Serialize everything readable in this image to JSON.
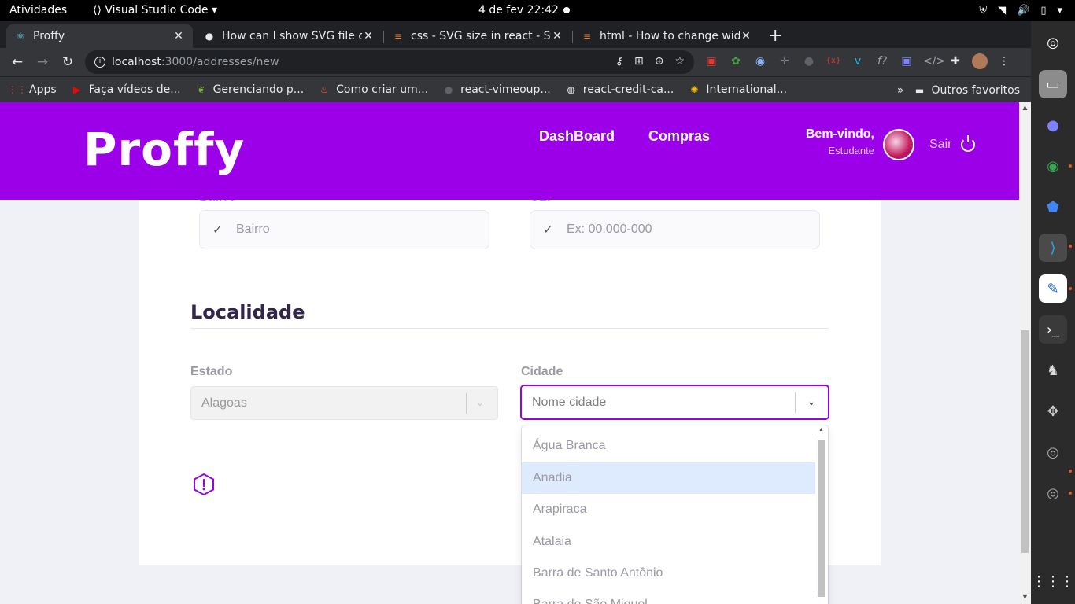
{
  "system_bar": {
    "activities": "Atividades",
    "app": "Visual Studio Code",
    "clock": "4 de fev  22:42"
  },
  "browser": {
    "tabs": [
      {
        "title": "Proffy",
        "favicon": "react-icon"
      },
      {
        "title": "How can I show SVG file o",
        "favicon": "github-icon"
      },
      {
        "title": "css - SVG size in react - Sta",
        "favicon": "stackoverflow-icon"
      },
      {
        "title": "html - How to change wid",
        "favicon": "stackoverflow-icon"
      }
    ],
    "url_host": "localhost",
    "url_path": ":3000/addresses/new",
    "bookmarks": [
      {
        "label": "Apps",
        "icon": "apps-grid-icon"
      },
      {
        "label": "Faça vídeos de...",
        "icon": "youtube-icon"
      },
      {
        "label": "Gerenciando p...",
        "icon": "leaf-icon"
      },
      {
        "label": "Como criar um...",
        "icon": "fire-icon"
      },
      {
        "label": "react-vimeoup...",
        "icon": "github-icon"
      },
      {
        "label": "react-credit-ca...",
        "icon": "globe-icon"
      },
      {
        "label": "International...",
        "icon": "peacock-icon"
      }
    ],
    "more": "»",
    "other_bookmarks": "Outros favoritos"
  },
  "app": {
    "logo": "Proffy",
    "nav": [
      "DashBoard",
      "Compras"
    ],
    "welcome": "Bem-vindo,",
    "role": "Estudante",
    "logout": "Sair",
    "fields": {
      "bairro": {
        "label": "Bairro",
        "placeholder": "Bairro"
      },
      "cep": {
        "label": "CEP",
        "placeholder": "Ex: 00.000-000"
      }
    },
    "section_title": "Localidade",
    "estado": {
      "label": "Estado",
      "value": "Alagoas"
    },
    "cidade": {
      "label": "Cidade",
      "placeholder": "Nome cidade"
    },
    "city_options": [
      "Água Branca",
      "Anadia",
      "Arapiraca",
      "Atalaia",
      "Barra de Santo Antônio",
      "Barra de São Miguel"
    ],
    "highlighted_option": "Anadia"
  },
  "colors": {
    "brand": "#9c00e8",
    "heading": "#32264d",
    "highlight": "#deebff"
  }
}
